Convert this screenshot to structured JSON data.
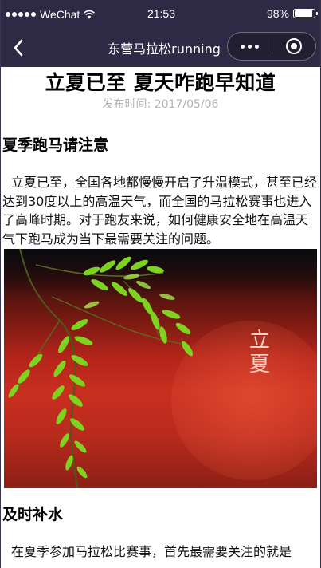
{
  "status_bar": {
    "carrier": "WeChat",
    "time": "21:53",
    "battery": "98%",
    "battery_level": 0.98,
    "signal_icon": "signal-dots",
    "wifi_icon": "wifi-icon"
  },
  "nav": {
    "back_icon": "back-chevron-icon",
    "title": "东营马拉松running",
    "more_icon": "more-dots-icon",
    "close_icon": "target-close-icon"
  },
  "article": {
    "title": "立夏已至 夏天咋跑早知道",
    "publish_label": "发布时间:",
    "publish_date": "2017/05/06",
    "section1_heading": "夏季跑马请注意",
    "section1_text": "立夏已至，全国各地都慢慢开启了升温模式，甚至已经达到30度以上的高温天气，而全国的马拉松赛事也进入了高峰时期。对于跑友来说，如何健康安全地在高温天气下跑马成为当下最需要关注的问题。",
    "image_caption": "立夏",
    "section2_heading": "及时补水",
    "section2_text": "在夏季参加马拉松比赛事，首先最需要关注的就是"
  },
  "colors": {
    "navbar_bg": "#2e2a45",
    "publish_gray": "#b3b3b3",
    "text": "#000000"
  }
}
